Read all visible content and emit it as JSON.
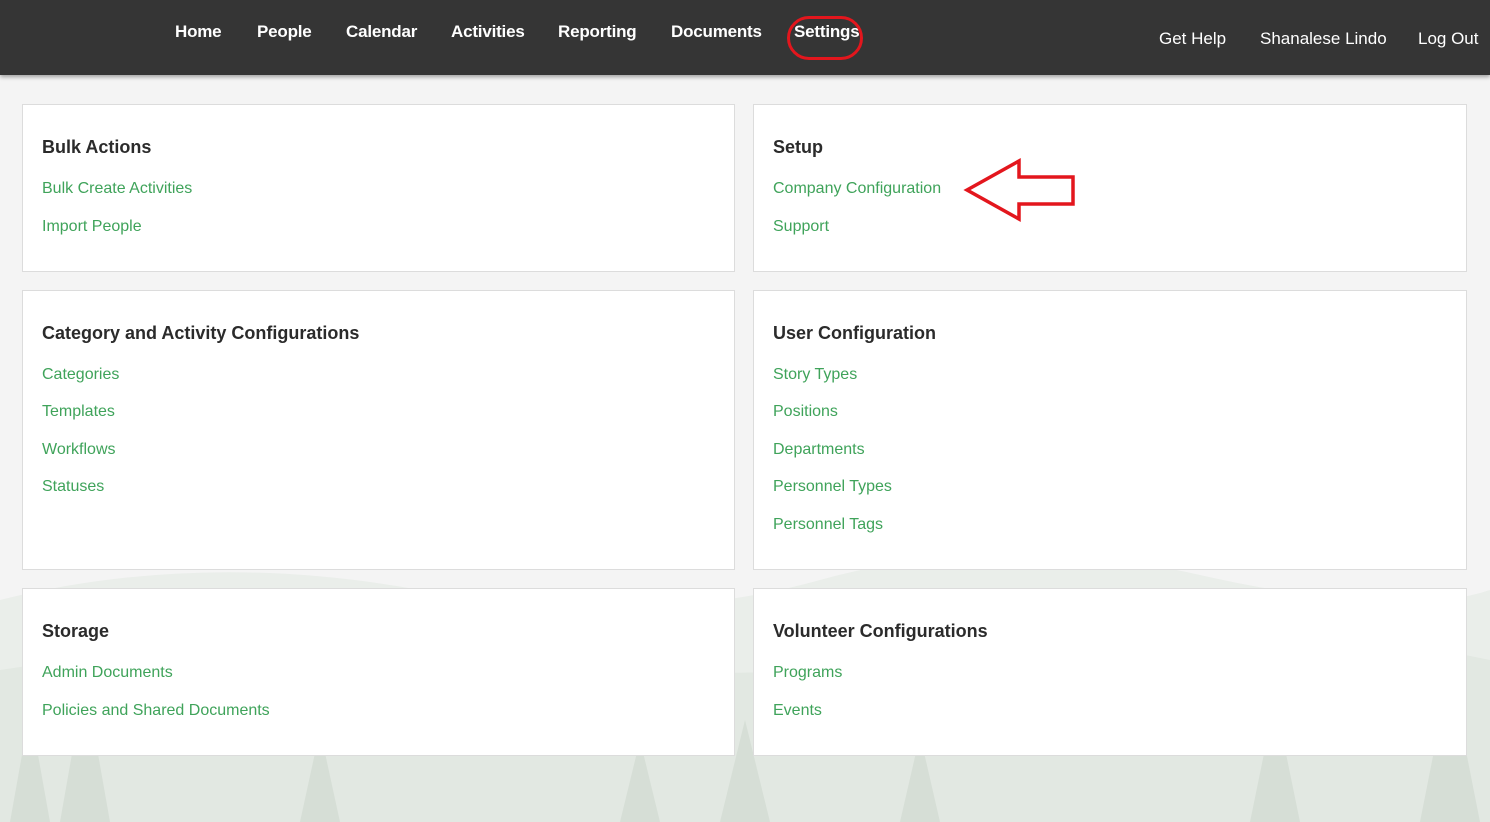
{
  "nav": {
    "items": [
      {
        "label": "Home"
      },
      {
        "label": "People"
      },
      {
        "label": "Calendar"
      },
      {
        "label": "Activities"
      },
      {
        "label": "Reporting"
      },
      {
        "label": "Documents"
      },
      {
        "label": "Settings"
      }
    ],
    "right": {
      "help": "Get Help",
      "user": "Shanalese Lindo",
      "logout": "Log Out"
    }
  },
  "cards": {
    "bulk_actions": {
      "title": "Bulk Actions",
      "links": [
        "Bulk Create Activities",
        "Import People"
      ]
    },
    "setup": {
      "title": "Setup",
      "links": [
        "Company Configuration",
        "Support"
      ]
    },
    "category_activity": {
      "title": "Category and Activity Configurations",
      "links": [
        "Categories",
        "Templates",
        "Workflows",
        "Statuses"
      ]
    },
    "user_config": {
      "title": "User Configuration",
      "links": [
        "Story Types",
        "Positions",
        "Departments",
        "Personnel Types",
        "Personnel Tags"
      ]
    },
    "storage": {
      "title": "Storage",
      "links": [
        "Admin Documents",
        "Policies and Shared Documents"
      ]
    },
    "volunteer": {
      "title": "Volunteer Configurations",
      "links": [
        "Programs",
        "Events"
      ]
    }
  },
  "colors": {
    "topbar": "#353535",
    "link": "#3fa35a",
    "annotation": "#e3161d"
  }
}
